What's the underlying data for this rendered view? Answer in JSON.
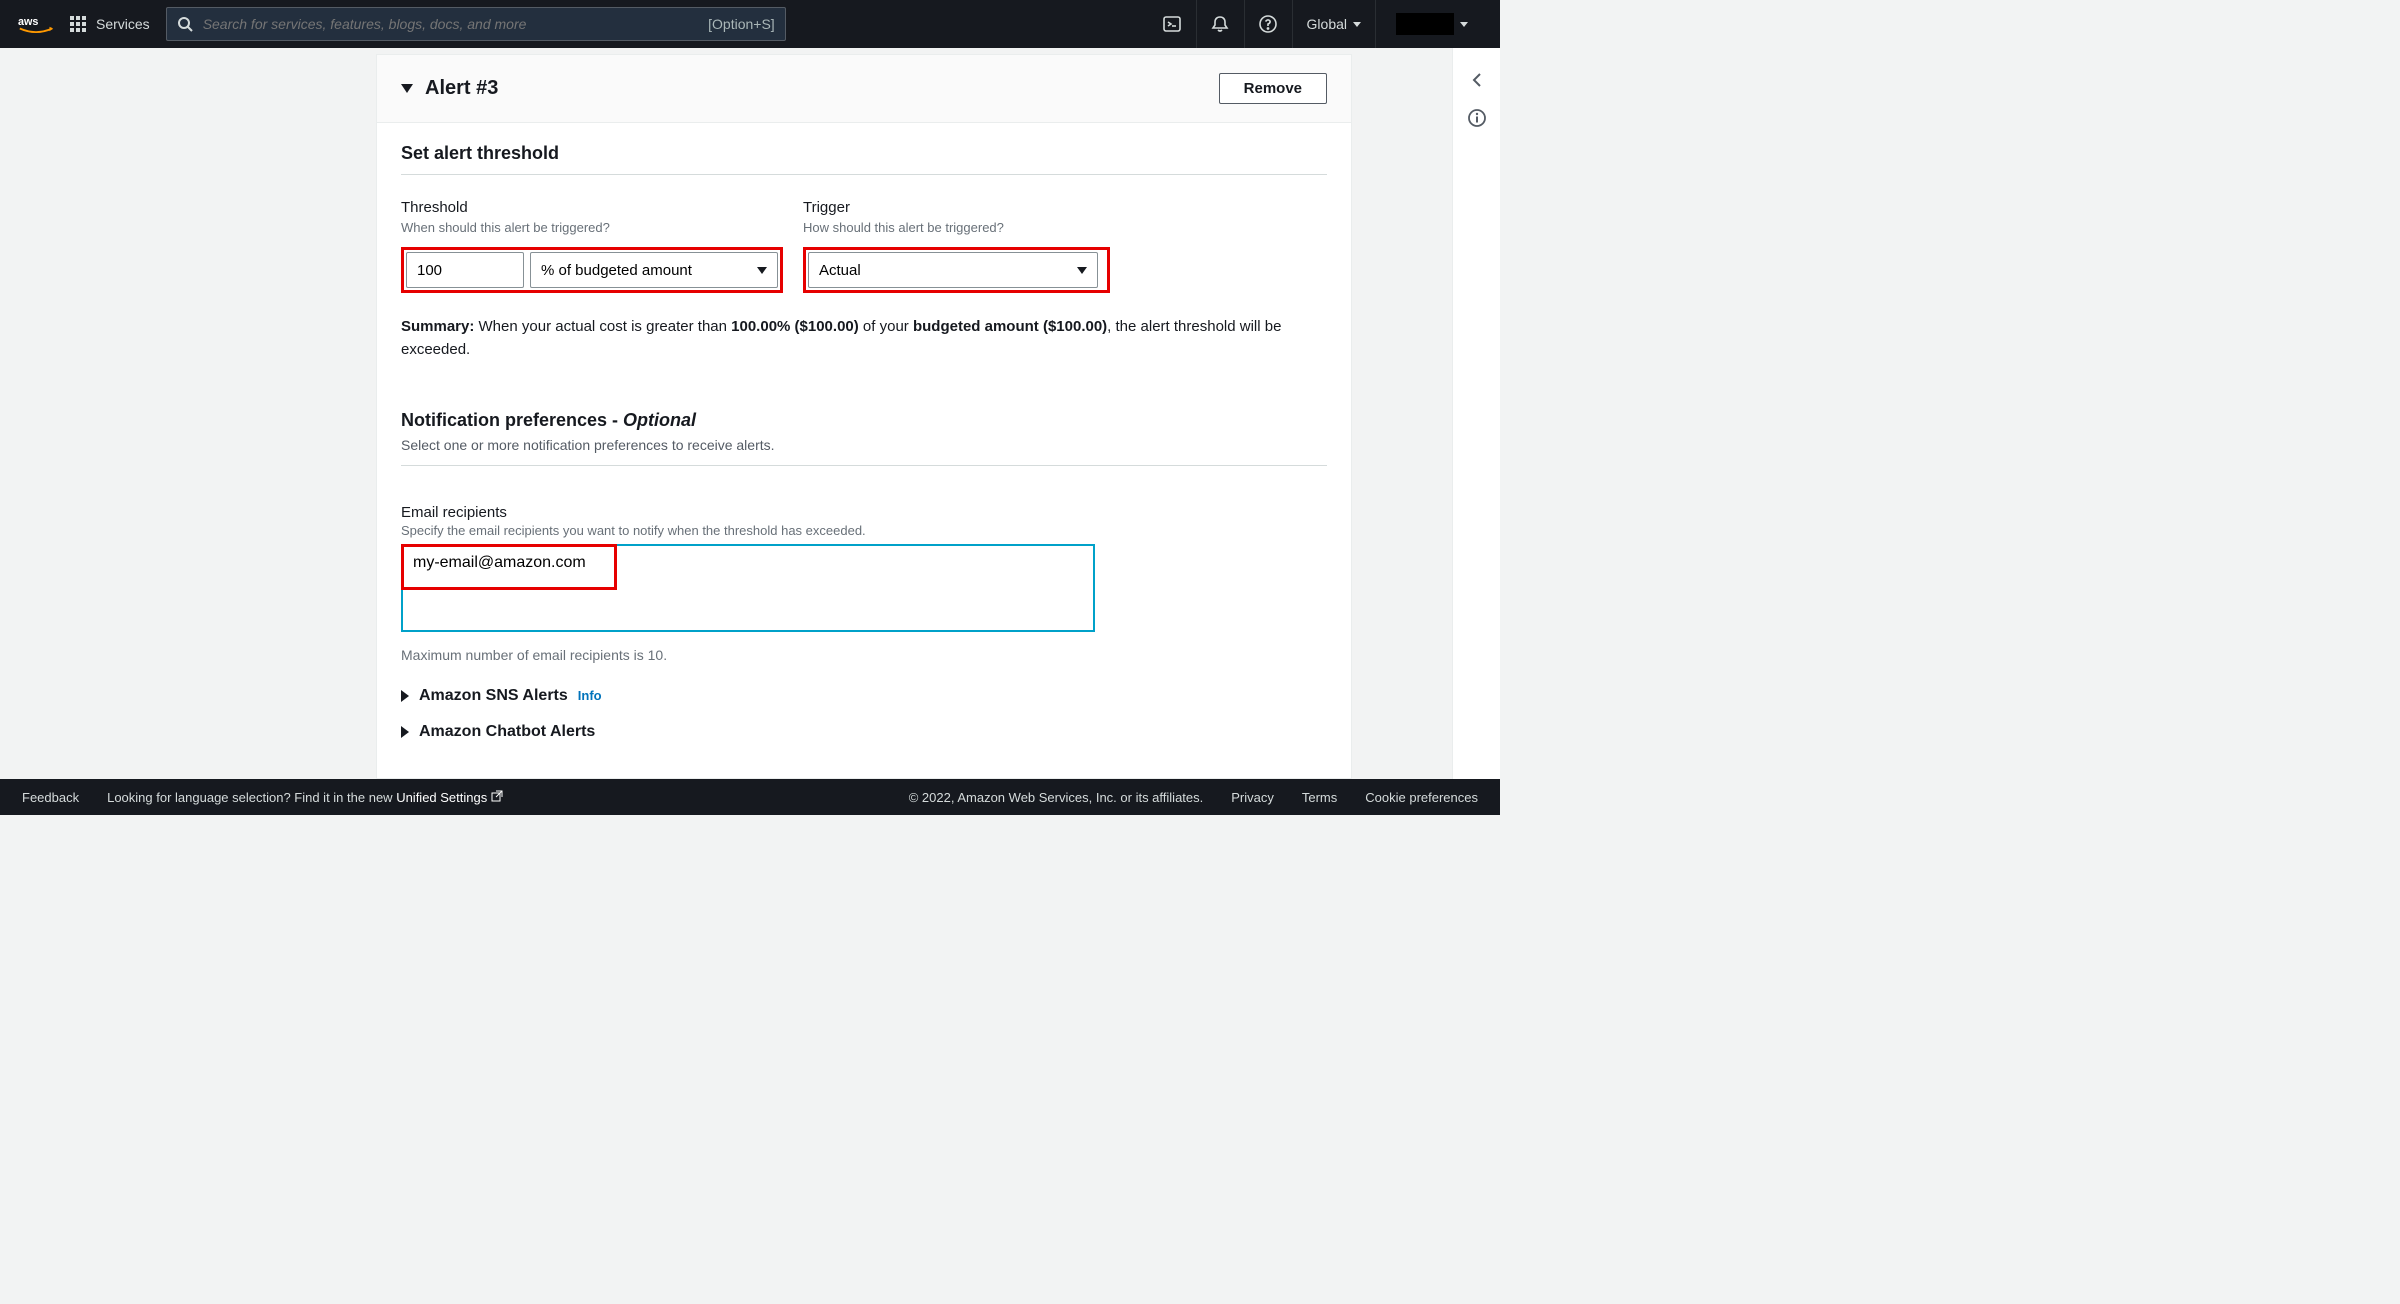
{
  "topnav": {
    "services_label": "Services",
    "search_placeholder": "Search for services, features, blogs, docs, and more",
    "search_hint": "[Option+S]",
    "region": "Global"
  },
  "panel": {
    "title": "Alert #3",
    "remove_label": "Remove"
  },
  "threshold_section": {
    "title": "Set alert threshold",
    "threshold_label": "Threshold",
    "threshold_help": "When should this alert be triggered?",
    "threshold_value": "100",
    "threshold_unit": "% of budgeted amount",
    "trigger_label": "Trigger",
    "trigger_help": "How should this alert be triggered?",
    "trigger_value": "Actual"
  },
  "summary": {
    "label": "Summary:",
    "text1": " When your actual cost is greater than ",
    "pct": "100.00% ($100.00)",
    "text2": " of your ",
    "amt": "budgeted amount ($100.00)",
    "text3": ", the alert threshold will be exceeded."
  },
  "notif": {
    "title_main": "Notification preferences - ",
    "title_opt": "Optional",
    "sub": "Select one or more notification preferences to receive alerts."
  },
  "email": {
    "label": "Email recipients",
    "help": "Specify the email recipients you want to notify when the threshold has exceeded.",
    "value": "my-email@amazon.com",
    "max": "Maximum number of email recipients is 10."
  },
  "expanders": {
    "sns": "Amazon SNS Alerts",
    "sns_info": "Info",
    "chatbot": "Amazon Chatbot Alerts"
  },
  "footer": {
    "feedback": "Feedback",
    "lang_text": "Looking for language selection? Find it in the new ",
    "unified": "Unified Settings",
    "copyright": "© 2022, Amazon Web Services, Inc. or its affiliates.",
    "privacy": "Privacy",
    "terms": "Terms",
    "cookies": "Cookie preferences"
  }
}
